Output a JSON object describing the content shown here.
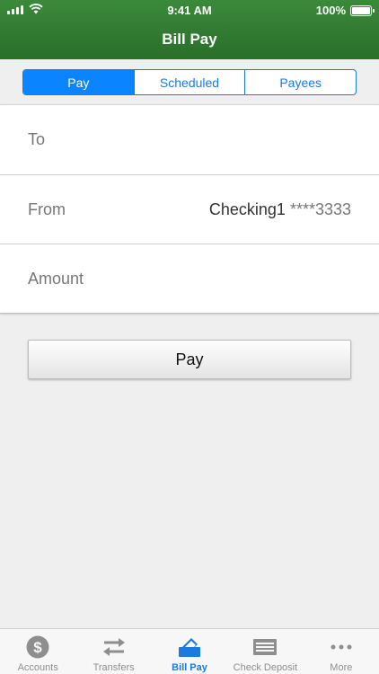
{
  "status_bar": {
    "time": "9:41 AM",
    "battery": "100%"
  },
  "nav": {
    "title": "Bill Pay"
  },
  "segments": [
    {
      "label": "Pay",
      "active": true
    },
    {
      "label": "Scheduled",
      "active": false
    },
    {
      "label": "Payees",
      "active": false
    }
  ],
  "form": {
    "to_label": "To",
    "from_label": "From",
    "from_account": "Checking1",
    "from_masked": "****3333",
    "amount_label": "Amount"
  },
  "pay_button": {
    "label": "Pay"
  },
  "tabbar": {
    "items": [
      {
        "label": "Accounts",
        "icon": "dollar-circle-icon",
        "active": false
      },
      {
        "label": "Transfers",
        "icon": "transfer-arrows-icon",
        "active": false
      },
      {
        "label": "Bill Pay",
        "icon": "bill-pay-icon",
        "active": true
      },
      {
        "label": "Check Deposit",
        "icon": "check-icon",
        "active": false
      },
      {
        "label": "More",
        "icon": "more-dots-icon",
        "active": false
      }
    ]
  },
  "colors": {
    "header_green": "#2e7a2f",
    "accent_blue": "#0a84ff",
    "background": "#efefef"
  }
}
